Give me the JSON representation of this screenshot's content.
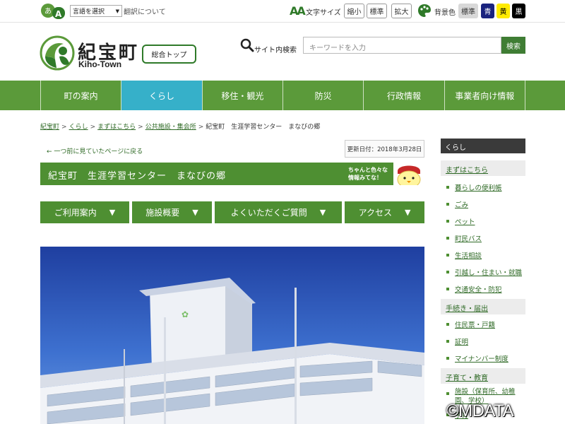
{
  "util": {
    "lang_select": "言語を選択",
    "lang_about": "翻訳について",
    "fontsize_label": "文字サイズ",
    "fontsize_buttons": [
      "縮小",
      "標準",
      "拡大"
    ],
    "bg_label": "背景色",
    "bg_buttons": [
      {
        "label": "標準",
        "bg": "#d8d8d8",
        "fg": "#333333"
      },
      {
        "label": "青",
        "bg": "#1a237e",
        "fg": "#ffffff"
      },
      {
        "label": "黄",
        "bg": "#ffeb00",
        "fg": "#000000"
      },
      {
        "label": "黒",
        "bg": "#000000",
        "fg": "#ffffff"
      }
    ]
  },
  "header": {
    "logo_jp": "紀宝町",
    "logo_en": "Kiho-Town",
    "top_button": "総合トップ",
    "search_label": "サイト内検索",
    "search_placeholder": "キーワードを入力",
    "search_button": "検索"
  },
  "gnav": {
    "items": [
      "町の案内",
      "くらし",
      "移住・観光",
      "防災",
      "行政情報",
      "事業者向け情報"
    ],
    "active_index": 1
  },
  "breadcrumb": {
    "links": [
      "紀宝町",
      "くらし",
      "まずはこちら",
      "公共施設・集会所"
    ],
    "current": "紀宝町　生涯学習センター　まなびの郷"
  },
  "back_link": "← 一つ前に見ていたページに戻る",
  "updated": "更新日付：2018年3月28日",
  "page": {
    "title": "紀宝町　生涯学習センター　まなびの郷",
    "mascot_text_1": "ちゃんと色々な",
    "mascot_text_2": "情報みてな！"
  },
  "tabs": [
    "ご利用案内",
    "施設概要",
    "よくいただくご質問",
    "アクセス"
  ],
  "sidebar": {
    "heading": "くらし",
    "sections": [
      {
        "title": "まずはこちら",
        "items": [
          "暮らしの便利帳",
          "ごみ",
          "ペット",
          "町民バス",
          "生活相談",
          "引越し・住まい・就職",
          "交通安全・防犯"
        ]
      },
      {
        "title": "手続き・届出",
        "items": [
          "住民票・戸籍",
          "証明",
          "マイナンバー制度"
        ]
      },
      {
        "title": "子育て・教育",
        "items": [
          "施設（保育所、幼稚園、学校）",
          "子育"
        ]
      }
    ]
  },
  "watermark": "©MDATA",
  "colors": {
    "brand_green": "#4e8f32",
    "nav_active": "#36b0c9"
  }
}
